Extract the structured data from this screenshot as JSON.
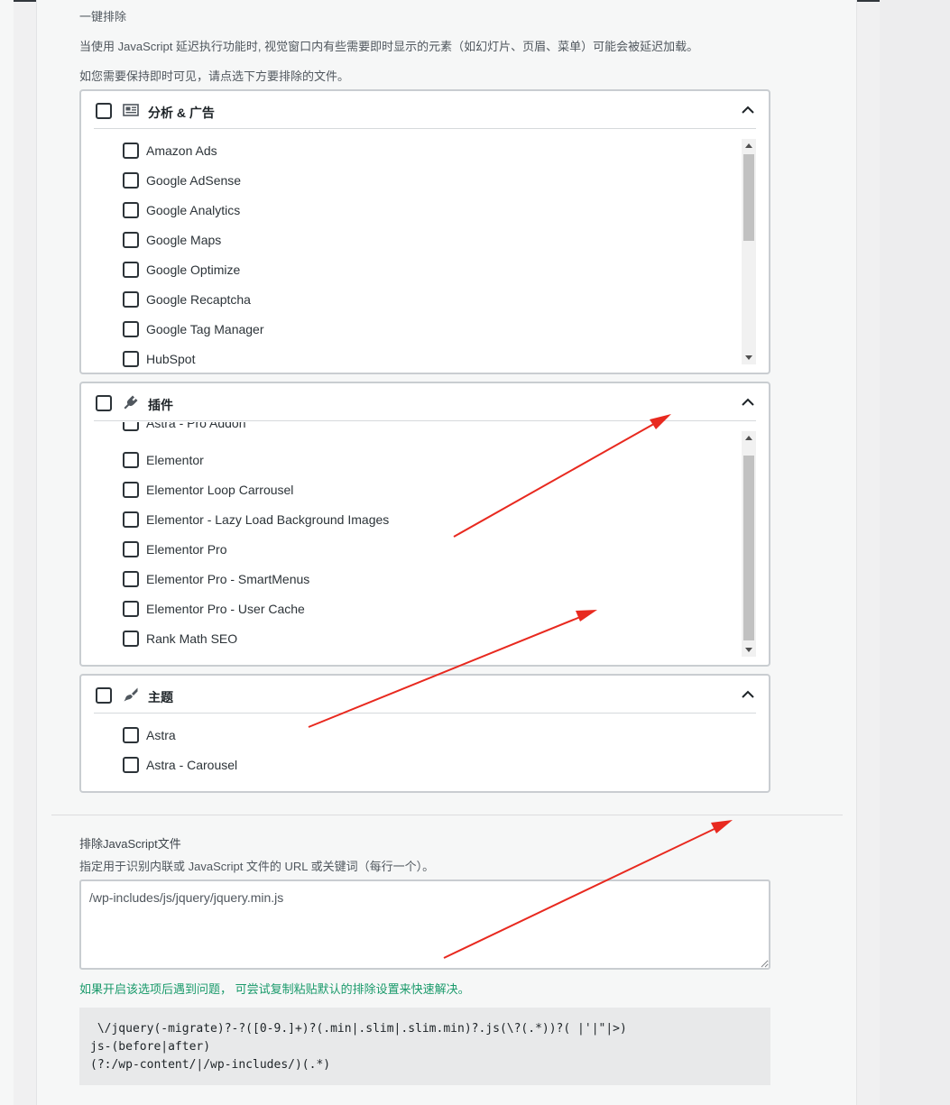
{
  "section": {
    "title": "一键排除",
    "desc1": "当使用 JavaScript 延迟执行功能时, 视觉窗口内有些需要即时显示的元素（如幻灯片、页眉、菜单）可能会被延迟加载。",
    "desc2": "如您需要保持即时可见，请点选下方要排除的文件。"
  },
  "groups": {
    "analytics": {
      "title": "分析 & 广告",
      "items": [
        "Amazon Ads",
        "Google AdSense",
        "Google Analytics",
        "Google Maps",
        "Google Optimize",
        "Google Recaptcha",
        "Google Tag Manager",
        "HubSpot"
      ]
    },
    "plugins": {
      "title": "插件",
      "items": [
        "Astra - Pro Addon",
        "Elementor",
        "Elementor Loop Carrousel",
        "Elementor - Lazy Load Background Images",
        "Elementor Pro",
        "Elementor Pro - SmartMenus",
        "Elementor Pro - User Cache",
        "Rank Math SEO"
      ]
    },
    "themes": {
      "title": "主题",
      "items": [
        "Astra",
        "Astra - Carousel"
      ]
    }
  },
  "exclude_js": {
    "title": "排除JavaScript文件",
    "desc": "指定用于识别内联或 JavaScript 文件的 URL 或关键词（每行一个）。",
    "value": "/wp-includes/js/jquery/jquery.min.js",
    "hint": "如果开启该选项后遇到问题， 可尝试复制粘贴默认的排除设置来快速解决。",
    "code": [
      " \\/jquery(-migrate)?-?([0-9.]+)?(.min|.slim|.slim.min)?.js(\\?(.*))?( |'|\"|>)",
      "js-(before|after)",
      "(?:/wp-content/|/wp-includes/)(.*)"
    ]
  },
  "colors": {
    "accent_green": "#1a9a6b",
    "arrow_red": "#e8291f"
  },
  "icons": {
    "analytics": "newspaper-icon",
    "plugins": "plugin-icon",
    "themes": "paintbrush-icon",
    "collapse": "chevron-up-icon"
  }
}
